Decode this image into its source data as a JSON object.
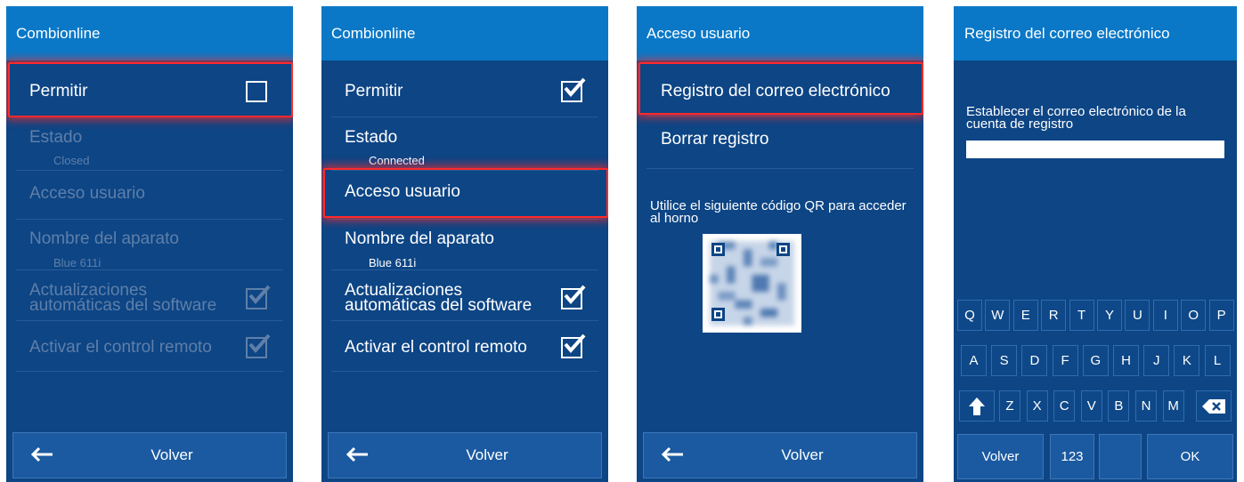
{
  "screen1": {
    "title": "Combionline",
    "items": {
      "permitir": {
        "label": "Permitir",
        "checked": false
      },
      "estado": {
        "label": "Estado",
        "value": "Closed"
      },
      "acceso": {
        "label": "Acceso usuario"
      },
      "nombre": {
        "label": "Nombre del aparato",
        "value": "Blue 611i"
      },
      "actualizaciones": {
        "line1": "Actualizaciones",
        "line2": "automáticas del software",
        "checked": true
      },
      "remoto": {
        "label": "Activar el control remoto",
        "checked": true
      }
    },
    "back_label": "Volver"
  },
  "screen2": {
    "title": "Combionline",
    "items": {
      "permitir": {
        "label": "Permitir",
        "checked": true
      },
      "estado": {
        "label": "Estado",
        "value": "Connected"
      },
      "acceso": {
        "label": "Acceso usuario"
      },
      "nombre": {
        "label": "Nombre del aparato",
        "value": "Blue 611i"
      },
      "actualizaciones": {
        "line1": "Actualizaciones",
        "line2": "automáticas del software",
        "checked": true
      },
      "remoto": {
        "label": "Activar el control remoto",
        "checked": true
      }
    },
    "back_label": "Volver"
  },
  "screen3": {
    "title": "Acceso usuario",
    "items": {
      "registro": {
        "label": "Registro del correo electrónico"
      },
      "borrar": {
        "label": "Borrar registro"
      }
    },
    "qr_text": "Utilice el siguiente código QR para acceder al horno",
    "back_label": "Volver"
  },
  "screen4": {
    "title": "Registro del correo electrónico",
    "prompt": "Establecer el correo electrónico de la cuenta de registro",
    "email_value": "",
    "keyboard": {
      "row1": [
        "Q",
        "W",
        "E",
        "R",
        "T",
        "Y",
        "U",
        "I",
        "O",
        "P"
      ],
      "row2": [
        "A",
        "S",
        "D",
        "F",
        "G",
        "H",
        "J",
        "K",
        "L"
      ],
      "row3": [
        "Z",
        "X",
        "C",
        "V",
        "B",
        "N",
        "M"
      ],
      "shift_icon": "shift-arrow-icon",
      "backspace_icon": "backspace-icon"
    },
    "buttons": {
      "volver": "Volver",
      "numbers": "123",
      "ok": "OK"
    }
  },
  "colors": {
    "header": "#0a78c7",
    "background": "#0d4585",
    "disabled_text": "#5f7fa8",
    "highlight": "#ff2a2a"
  }
}
